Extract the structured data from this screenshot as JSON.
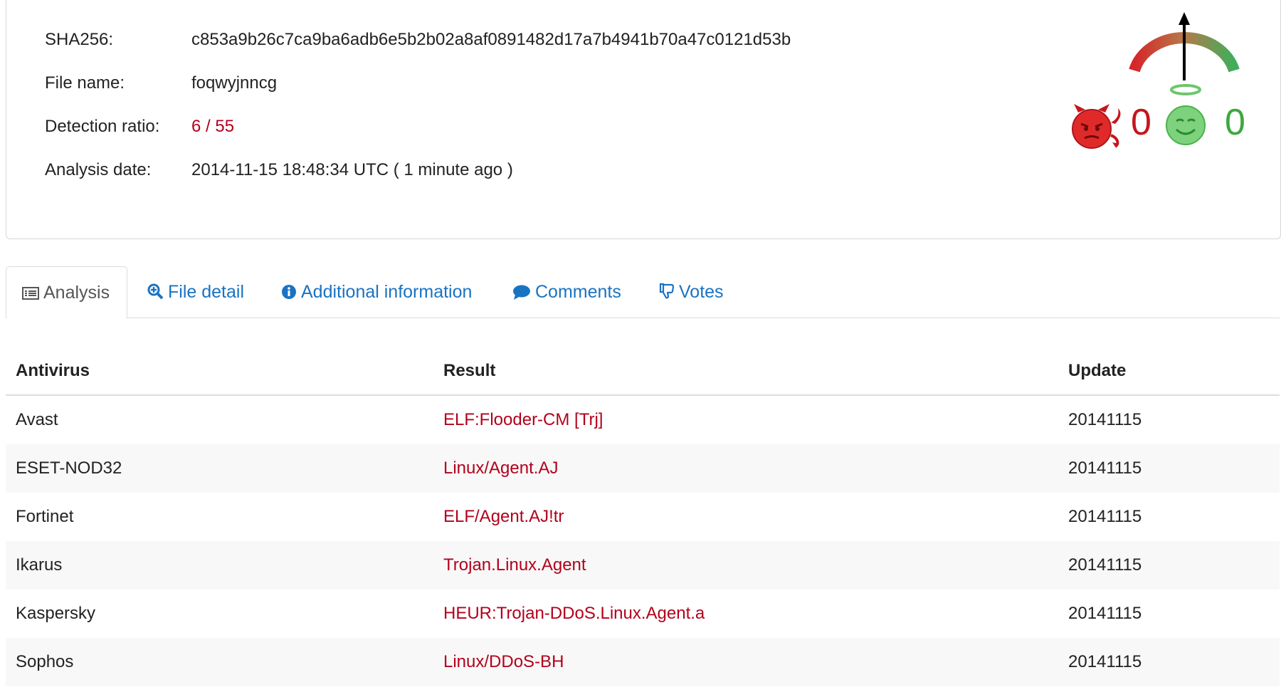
{
  "summary": {
    "sha256_label": "SHA256:",
    "sha256_value": "c853a9b26c7ca9ba6adb6e5b2b02a8af0891482d17a7b4941b70a47c0121d53b",
    "filename_label": "File name:",
    "filename_value": "foqwyjnncg",
    "ratio_label": "Detection ratio:",
    "ratio_value": "6 / 55",
    "date_label": "Analysis date:",
    "date_value": "2014-11-15 18:48:34 UTC ( 1 minute ago )"
  },
  "community": {
    "malicious_votes": "0",
    "harmless_votes": "0",
    "malicious_icon": "devil-face-icon",
    "harmless_icon": "angel-face-icon",
    "gauge_needle_position": 0.5
  },
  "tabs": [
    {
      "label": "Analysis",
      "icon": "list-icon"
    },
    {
      "label": "File detail",
      "icon": "magnify-plus-icon"
    },
    {
      "label": "Additional information",
      "icon": "info-icon"
    },
    {
      "label": "Comments",
      "icon": "speech-bubble-icon"
    },
    {
      "label": "Votes",
      "icon": "thumbs-down-icon"
    }
  ],
  "table": {
    "headers": {
      "antivirus": "Antivirus",
      "result": "Result",
      "update": "Update"
    },
    "rows": [
      {
        "antivirus": "Avast",
        "result": "ELF:Flooder-CM [Trj]",
        "update": "20141115"
      },
      {
        "antivirus": "ESET-NOD32",
        "result": "Linux/Agent.AJ",
        "update": "20141115"
      },
      {
        "antivirus": "Fortinet",
        "result": "ELF/Agent.AJ!tr",
        "update": "20141115"
      },
      {
        "antivirus": "Ikarus",
        "result": "Trojan.Linux.Agent",
        "update": "20141115"
      },
      {
        "antivirus": "Kaspersky",
        "result": "HEUR:Trojan-DDoS.Linux.Agent.a",
        "update": "20141115"
      },
      {
        "antivirus": "Sophos",
        "result": "Linux/DDoS-BH",
        "update": "20141115"
      }
    ]
  },
  "colors": {
    "link": "#1a73c2",
    "danger": "#b3001b",
    "bad_vote": "#c4161c",
    "good_vote": "#3ea83e"
  }
}
